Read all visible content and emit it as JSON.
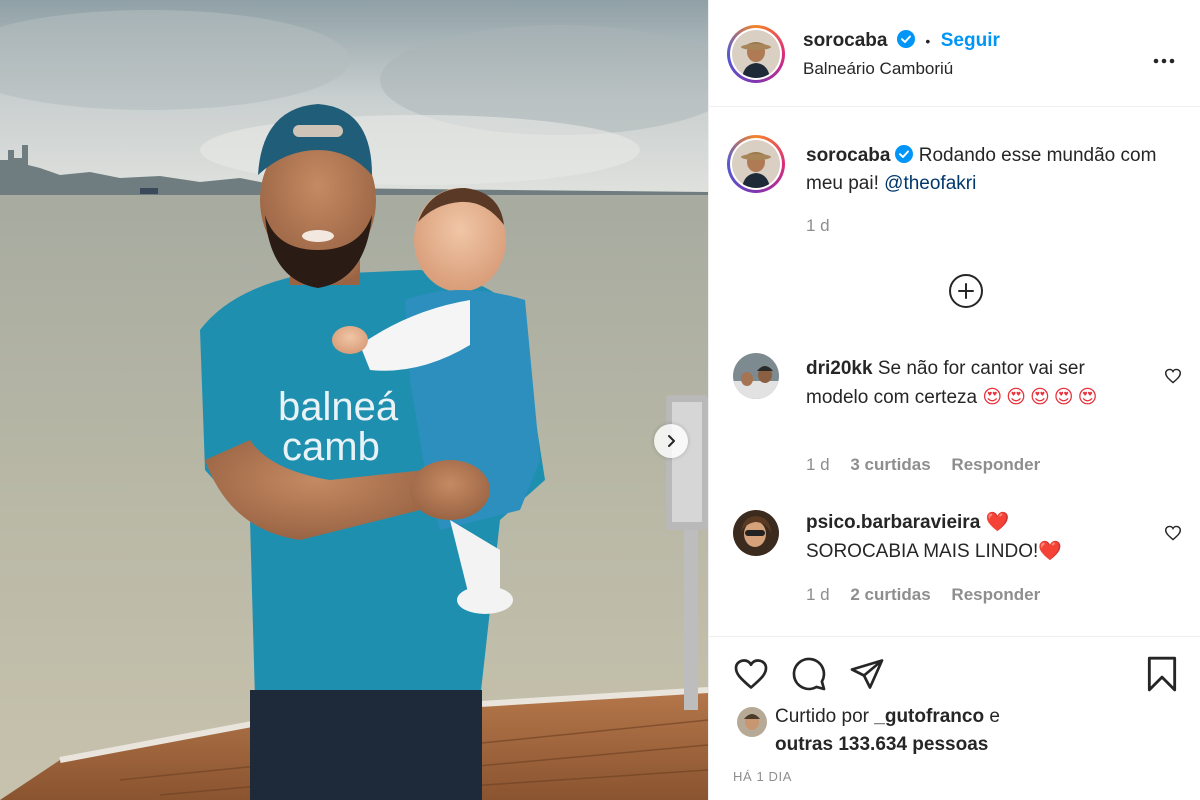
{
  "post": {
    "author": {
      "username": "sorocaba",
      "verified": true,
      "location": "Balneário Camboriú"
    },
    "follow_label": "Seguir",
    "separator": "•",
    "more_icon": "more-dots-icon",
    "photo": {
      "shirt_text_line1": "balneá",
      "shirt_text_line2": "camb",
      "next_icon": "chevron-right-icon"
    },
    "caption": {
      "username": "sorocaba",
      "text": "Rodando esse mundão com meu pai!",
      "mention": "@theofakri",
      "time": "1 d"
    },
    "load_more_icon": "plus-circle-icon",
    "comments": [
      {
        "username": "dri20kk",
        "text": "Se não for cantor vai ser modelo com certeza",
        "emojis": "😍😍😍😍😍",
        "time": "1 d",
        "likes": "3 curtidas",
        "reply": "Responder"
      },
      {
        "username": "psico.barbaravieira",
        "username_suffix": "❤️",
        "text": "SOROCABIA MAIS LINDO!",
        "emojis": "❤️",
        "time": "1 d",
        "likes": "2 curtidas",
        "reply": "Responder"
      }
    ],
    "actions": {
      "like_icon": "heart-icon",
      "comment_icon": "comment-icon",
      "share_icon": "paper-plane-icon",
      "save_icon": "bookmark-icon"
    },
    "likes": {
      "prefix": "Curtido por",
      "user": "_gutofranco",
      "conjunction": "e",
      "others": "outras 133.634 pessoas"
    },
    "posted_ago": "HÁ 1 DIA"
  },
  "colors": {
    "link_blue": "#0095f6",
    "mention_blue": "#00376b",
    "muted_gray": "#8e8e8e",
    "text_dark": "#262626",
    "shirt_teal": "#1f8fb0"
  }
}
